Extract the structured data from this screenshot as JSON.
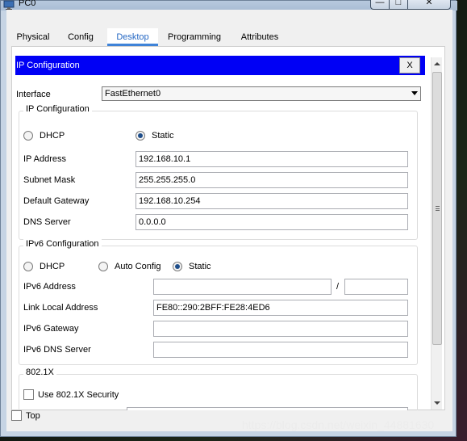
{
  "window": {
    "title": "PC0"
  },
  "tabs": [
    "Physical",
    "Config",
    "Desktop",
    "Programming",
    "Attributes"
  ],
  "active_tab": "Desktop",
  "ip_config_header": {
    "title": "IP Configuration",
    "close_label": "X"
  },
  "interface": {
    "label": "Interface",
    "value": "FastEthernet0"
  },
  "ipv4": {
    "group_title": "IP Configuration",
    "dhcp_label": "DHCP",
    "static_label": "Static",
    "mode": "Static",
    "fields": [
      {
        "label": "IP Address",
        "value": "192.168.10.1"
      },
      {
        "label": "Subnet Mask",
        "value": "255.255.255.0"
      },
      {
        "label": "Default Gateway",
        "value": "192.168.10.254"
      },
      {
        "label": "DNS Server",
        "value": "0.0.0.0"
      }
    ]
  },
  "ipv6": {
    "group_title": "IPv6 Configuration",
    "dhcp_label": "DHCP",
    "auto_label": "Auto Config",
    "static_label": "Static",
    "mode": "Static",
    "address_label": "IPv6 Address",
    "address_value": "",
    "prefix_separator": "/",
    "prefix_value": "",
    "link_local_label": "Link Local Address",
    "link_local_value": "FE80::290:2BFF:FE28:4ED6",
    "gateway_label": "IPv6 Gateway",
    "gateway_value": "",
    "dns_label": "IPv6 DNS Server",
    "dns_value": ""
  },
  "dot1x": {
    "group_title": "802.1X",
    "checkbox_label": "Use 802.1X Security",
    "checked": false
  },
  "footer": {
    "top_label": "Top",
    "top_checked": false
  },
  "watermark": "https://blog.csdn.net/weixin_44881630",
  "colors": {
    "header_blue": "#0000f5",
    "tab_active": "#2769c4"
  }
}
